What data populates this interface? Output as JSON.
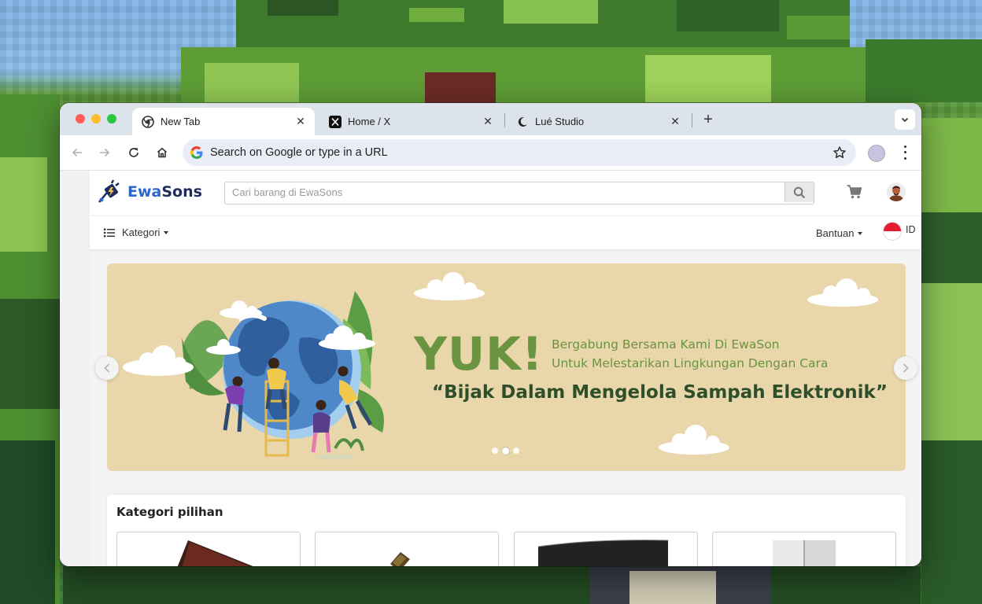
{
  "browser": {
    "tabs": [
      {
        "title": "New Tab",
        "active": true,
        "favicon": "chrome-icon"
      },
      {
        "title": "Home / X",
        "active": false,
        "favicon": "x-logo-icon"
      },
      {
        "title": "Lué Studio",
        "active": false,
        "favicon": "moon-icon"
      }
    ],
    "address_placeholder": "Search on Google or type in a URL"
  },
  "site": {
    "brand_prefix": "Ewa",
    "brand_suffix": "Sons",
    "search_placeholder": "Cari barang di EwaSons",
    "nav": {
      "kategori_label": "Kategori",
      "bantuan_label": "Bantuan",
      "language_code": "ID"
    },
    "banner": {
      "headline": "YUK!",
      "line1": "Bergabung Bersama Kami  Di EwaSon",
      "line2": "Untuk Melestarikan Lingkungan  Dengan Cara",
      "quote": "“Bijak Dalam Mengelola Sampah Elektronik”",
      "slide_count": 3,
      "active_slide": 2
    },
    "categories_title": "Kategori pilihan"
  },
  "colors": {
    "brand_dark": "#1d2c5b",
    "brand_blue": "#2f66c9",
    "banner_bg": "#e9d7ab",
    "banner_green": "#6a9440",
    "banner_quote": "#2e4f2a"
  }
}
